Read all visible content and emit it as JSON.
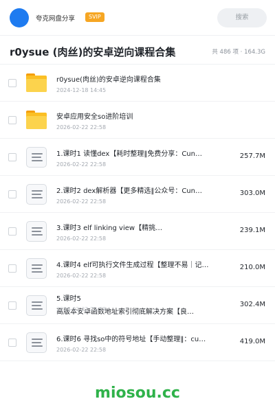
{
  "header": {
    "user_name": "夸克网盘分享",
    "badge": "SVIP",
    "search_label": "搜索"
  },
  "title_bar": {
    "title": "r0ysue (肉丝)的安卓逆向课程合集",
    "summary": "共 486 项 · 164.3G"
  },
  "files": [
    {
      "type": "folder",
      "name": "r0ysue(肉丝)的安卓逆向课程合集",
      "date": "2024-12-18 14:45",
      "size": ""
    },
    {
      "type": "folder",
      "name": "安卓应用安全so进阶培训",
      "date": "2026-02-22 22:58",
      "size": ""
    },
    {
      "type": "file",
      "name": "1.课时1 读懂dex【耗时整理‖免费分享：Cun…",
      "date": "2026-02-22 22:58",
      "size": "257.7M"
    },
    {
      "type": "file",
      "name": "2.课时2 dex解析器【更多精选‖公众号：Cun…",
      "date": "2026-02-22 22:58",
      "size": "303.0M"
    },
    {
      "type": "file",
      "name": "3.课时3 elf linking view【精挑…",
      "date": "2026-02-22 22:58",
      "size": "239.1M"
    },
    {
      "type": "file",
      "name": "4.课时4 elf可执行文件生成过程【整理不易｜记…",
      "date": "2026-02-22 22:58",
      "size": "210.0M"
    },
    {
      "type": "file",
      "name": "5.课时5",
      "name_line2": "高版本安卓函数地址索引彻底解决方案【良…",
      "date": "2026-02-22 22:58",
      "size": "302.4M"
    },
    {
      "type": "file",
      "name": "6.课时6 寻找so中的符号地址【手动整理‖：cu…",
      "date": "2026-02-22 22:58",
      "size": "419.0M"
    }
  ],
  "watermark": "miosou.cc",
  "colors": {
    "accent_blue": "#1e7bf0",
    "svip_orange": "#f6a623",
    "folder_yellow": "#fcd34d",
    "watermark_green": "#2fb24a"
  },
  "icons": {
    "folder": "folder-icon",
    "document": "document-icon"
  }
}
